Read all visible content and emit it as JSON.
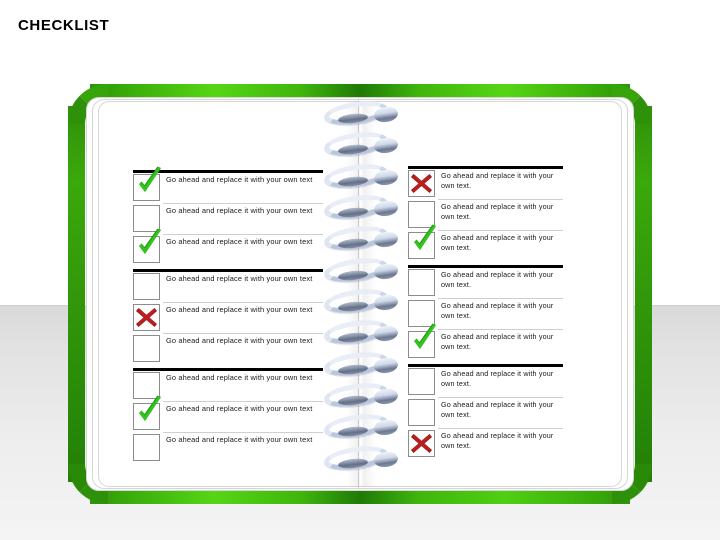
{
  "slide": {
    "title": "CHECKLIST",
    "background_color": "#ffffff",
    "band_color": "#e6e6e6",
    "accent_green": "#39a80b",
    "check_color": "#2aa81a",
    "cross_color": "#9e1b1b"
  },
  "notebook": {
    "spiral_ring_count": 12,
    "binding_icon": "spiral-binding-icon"
  },
  "left_page": {
    "groups": [
      {
        "items": [
          {
            "state": "checked",
            "icon": "check-icon",
            "text": "Go ahead and replace it with your own text"
          },
          {
            "state": "empty",
            "icon": "empty-checkbox-icon",
            "text": "Go ahead and replace it with your own text"
          },
          {
            "state": "checked",
            "icon": "check-icon",
            "text": "Go ahead and replace it with your own text"
          }
        ]
      },
      {
        "items": [
          {
            "state": "empty",
            "icon": "empty-checkbox-icon",
            "text": "Go ahead and replace it with your own text"
          },
          {
            "state": "crossed",
            "icon": "cross-icon",
            "text": "Go ahead and replace it with your own text"
          },
          {
            "state": "empty",
            "icon": "empty-checkbox-icon",
            "text": "Go ahead and replace it with your own text"
          }
        ]
      },
      {
        "items": [
          {
            "state": "empty",
            "icon": "empty-checkbox-icon",
            "text": "Go ahead and replace it with your own text"
          },
          {
            "state": "checked",
            "icon": "check-icon",
            "text": "Go ahead and replace it with your own text"
          },
          {
            "state": "empty",
            "icon": "empty-checkbox-icon",
            "text": "Go ahead and replace it with your own text"
          }
        ]
      }
    ]
  },
  "right_page": {
    "groups": [
      {
        "items": [
          {
            "state": "crossed",
            "icon": "cross-icon",
            "text": "Go ahead and replace it with your own text."
          },
          {
            "state": "empty",
            "icon": "empty-checkbox-icon",
            "text": "Go ahead and replace it with your own text."
          },
          {
            "state": "checked",
            "icon": "check-icon",
            "text": "Go ahead and replace it with your own text."
          }
        ]
      },
      {
        "items": [
          {
            "state": "empty",
            "icon": "empty-checkbox-icon",
            "text": "Go ahead and replace it with your own text."
          },
          {
            "state": "empty",
            "icon": "empty-checkbox-icon",
            "text": "Go ahead and replace it with your own text."
          },
          {
            "state": "checked",
            "icon": "check-icon",
            "text": "Go ahead and replace it with your own text."
          }
        ]
      },
      {
        "items": [
          {
            "state": "empty",
            "icon": "empty-checkbox-icon",
            "text": "Go ahead and replace it with your own text."
          },
          {
            "state": "empty",
            "icon": "empty-checkbox-icon",
            "text": "Go ahead and replace it with your own text."
          },
          {
            "state": "crossed",
            "icon": "cross-icon",
            "text": "Go ahead and replace it with your own text."
          }
        ]
      }
    ]
  }
}
